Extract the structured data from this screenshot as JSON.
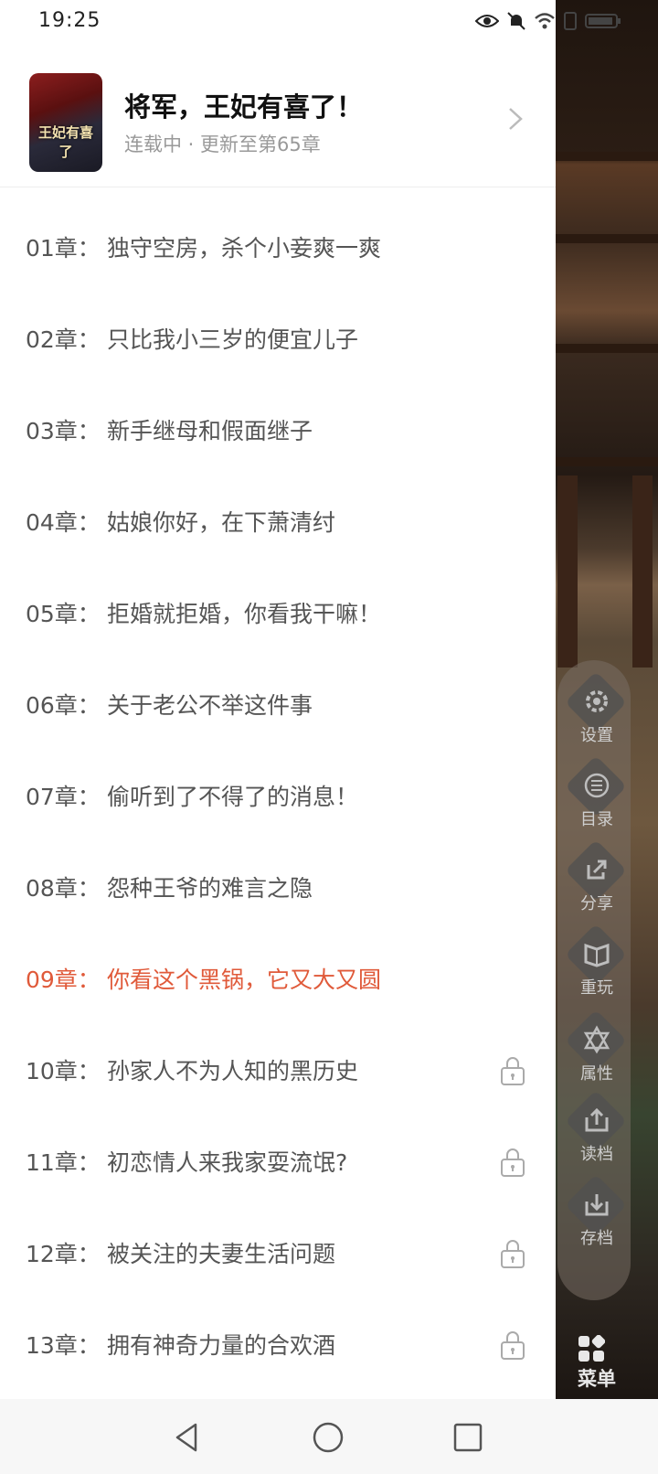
{
  "status_bar": {
    "time": "19:25",
    "icons": [
      "eye-icon",
      "bell-muted-icon",
      "wifi-icon",
      "sim-icon",
      "battery-icon"
    ]
  },
  "book": {
    "title": "将军，王妃有喜了！",
    "meta": "连载中 · 更新至第65章",
    "cover_title": "王妃有喜了"
  },
  "chapters": [
    {
      "num": "01章：",
      "name": "独守空房，杀个小妾爽一爽",
      "locked": false,
      "active": false
    },
    {
      "num": "02章：",
      "name": "只比我小三岁的便宜儿子",
      "locked": false,
      "active": false
    },
    {
      "num": "03章：",
      "name": "新手继母和假面继子",
      "locked": false,
      "active": false
    },
    {
      "num": "04章：",
      "name": "姑娘你好，在下萧清纣",
      "locked": false,
      "active": false
    },
    {
      "num": "05章：",
      "name": "拒婚就拒婚，你看我干嘛！",
      "locked": false,
      "active": false
    },
    {
      "num": "06章：",
      "name": "关于老公不举这件事",
      "locked": false,
      "active": false
    },
    {
      "num": "07章：",
      "name": "偷听到了不得了的消息！",
      "locked": false,
      "active": false
    },
    {
      "num": "08章：",
      "name": "怨种王爷的难言之隐",
      "locked": false,
      "active": false
    },
    {
      "num": "09章：",
      "name": "你看这个黑锅，它又大又圆",
      "locked": false,
      "active": true
    },
    {
      "num": "10章：",
      "name": "孙家人不为人知的黑历史",
      "locked": true,
      "active": false
    },
    {
      "num": "11章：",
      "name": "初恋情人来我家耍流氓?",
      "locked": true,
      "active": false
    },
    {
      "num": "12章：",
      "name": "被关注的夫妻生活问题",
      "locked": true,
      "active": false
    },
    {
      "num": "13章：",
      "name": "拥有神奇力量的合欢酒",
      "locked": true,
      "active": false
    }
  ],
  "side_menu": {
    "items": [
      {
        "label": "设置",
        "icon": "gear-icon"
      },
      {
        "label": "目录",
        "icon": "list-icon"
      },
      {
        "label": "分享",
        "icon": "share-icon"
      },
      {
        "label": "重玩",
        "icon": "replay-book-icon"
      },
      {
        "label": "属性",
        "icon": "star-icon"
      },
      {
        "label": "读档",
        "icon": "load-icon"
      },
      {
        "label": "存档",
        "icon": "save-icon"
      }
    ],
    "main_label": "菜单"
  },
  "colors": {
    "active_chapter": "#e05a3a",
    "chapter_text": "#555555",
    "meta_text": "#999999"
  }
}
